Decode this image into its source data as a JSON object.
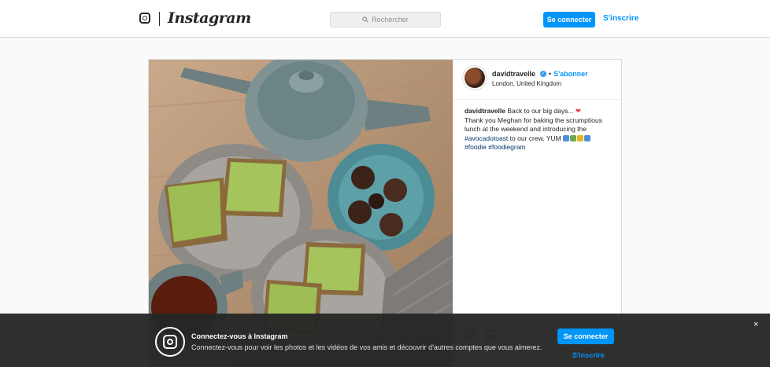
{
  "nav": {
    "logo_icon": "instagram-glyph-icon",
    "wordmark": "Instagram",
    "search_placeholder": "Rechercher",
    "login_label": "Se connecter",
    "signup_label": "S'inscrire"
  },
  "post": {
    "username": "davidtravelle",
    "verified": true,
    "follow_label": "S'abonner",
    "location": "London, United Kingdom",
    "caption": {
      "user": "davidtravelle",
      "line1": "Back to our big days...",
      "line2": "Thank you Meghan for baking the scrumptious",
      "line3": "lunch at the weekend and introducing the",
      "tag1": "#avocadotoast",
      "line4_rest": "to our crew. YUM",
      "tag2": "#foodie",
      "tag3": "#foodiegram"
    },
    "photo_description_icon": "food-photo"
  },
  "banner": {
    "title": "Connectez-vous à Instagram",
    "text": "Connectez-vous pour voir les photos et les vidéos de vos amis et découvrir d'autres comptes que vous aimerez.",
    "login_label": "Se connecter",
    "signup_label": "S'inscrire",
    "close_glyph": "×"
  },
  "colors": {
    "accent": "#0095f6",
    "banner_bg": "#262626",
    "page_bg": "#fafafa"
  }
}
